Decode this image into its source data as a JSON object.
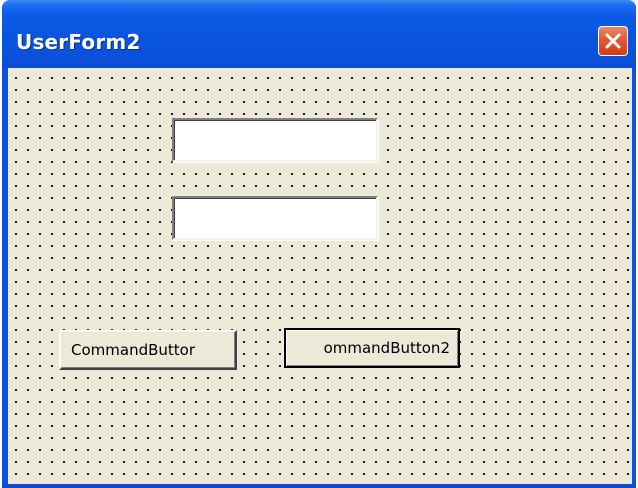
{
  "window": {
    "title": "UserForm2"
  },
  "controls": {
    "textbox1_value": "",
    "textbox2_value": "",
    "command_button_1_label": "CommandButtor",
    "command_button_2_label": "ommandButton2"
  },
  "colors": {
    "titlebar": "#0a55e0",
    "form_background": "#ece9d8",
    "close_button": "#de5b35"
  },
  "icons": {
    "close": "close-icon"
  }
}
